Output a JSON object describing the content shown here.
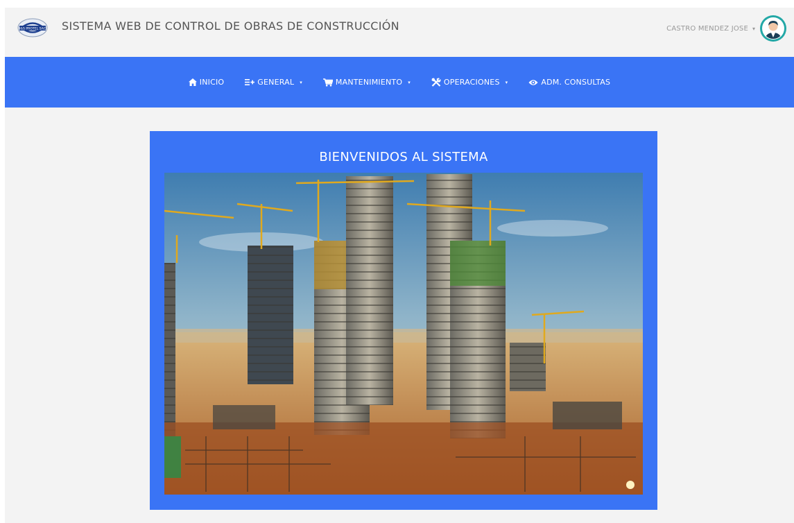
{
  "header": {
    "app_title": "SISTEMA WEB DE CONTROL DE OBRAS DE CONSTRUCCIÓN",
    "logo_text": "I&S PROTEL SAC",
    "user_name": "CASTRO MENDEZ JOSE",
    "user_caret": "▾"
  },
  "nav": {
    "items": [
      {
        "label": "INICIO",
        "icon": "home-icon",
        "dropdown": false
      },
      {
        "label": "GENERAL",
        "icon": "list-plus-icon",
        "dropdown": true
      },
      {
        "label": "MANTENIMIENTO",
        "icon": "cart-icon",
        "dropdown": true
      },
      {
        "label": "OPERACIONES",
        "icon": "tools-icon",
        "dropdown": true
      },
      {
        "label": "ADM. CONSULTAS",
        "icon": "eye-icon",
        "dropdown": false
      }
    ]
  },
  "main": {
    "welcome_title": "BIENVENIDOS AL SISTEMA",
    "image_alt": "construction-site-photo"
  },
  "colors": {
    "primary": "#3a74f5",
    "header_bg": "#f3f3f3",
    "avatar_ring": "#23a8a6"
  }
}
